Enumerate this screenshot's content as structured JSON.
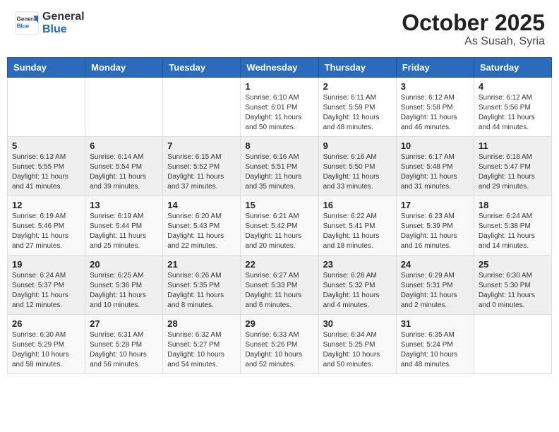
{
  "header": {
    "logo_general": "General",
    "logo_blue": "Blue",
    "month_title": "October 2025",
    "location": "As Susah, Syria"
  },
  "days_of_week": [
    "Sunday",
    "Monday",
    "Tuesday",
    "Wednesday",
    "Thursday",
    "Friday",
    "Saturday"
  ],
  "weeks": [
    [
      {
        "day": "",
        "info": ""
      },
      {
        "day": "",
        "info": ""
      },
      {
        "day": "",
        "info": ""
      },
      {
        "day": "1",
        "info": "Sunrise: 6:10 AM\nSunset: 6:01 PM\nDaylight: 11 hours\nand 50 minutes."
      },
      {
        "day": "2",
        "info": "Sunrise: 6:11 AM\nSunset: 5:59 PM\nDaylight: 11 hours\nand 48 minutes."
      },
      {
        "day": "3",
        "info": "Sunrise: 6:12 AM\nSunset: 5:58 PM\nDaylight: 11 hours\nand 46 minutes."
      },
      {
        "day": "4",
        "info": "Sunrise: 6:12 AM\nSunset: 5:56 PM\nDaylight: 11 hours\nand 44 minutes."
      }
    ],
    [
      {
        "day": "5",
        "info": "Sunrise: 6:13 AM\nSunset: 5:55 PM\nDaylight: 11 hours\nand 41 minutes."
      },
      {
        "day": "6",
        "info": "Sunrise: 6:14 AM\nSunset: 5:54 PM\nDaylight: 11 hours\nand 39 minutes."
      },
      {
        "day": "7",
        "info": "Sunrise: 6:15 AM\nSunset: 5:52 PM\nDaylight: 11 hours\nand 37 minutes."
      },
      {
        "day": "8",
        "info": "Sunrise: 6:16 AM\nSunset: 5:51 PM\nDaylight: 11 hours\nand 35 minutes."
      },
      {
        "day": "9",
        "info": "Sunrise: 6:16 AM\nSunset: 5:50 PM\nDaylight: 11 hours\nand 33 minutes."
      },
      {
        "day": "10",
        "info": "Sunrise: 6:17 AM\nSunset: 5:48 PM\nDaylight: 11 hours\nand 31 minutes."
      },
      {
        "day": "11",
        "info": "Sunrise: 6:18 AM\nSunset: 5:47 PM\nDaylight: 11 hours\nand 29 minutes."
      }
    ],
    [
      {
        "day": "12",
        "info": "Sunrise: 6:19 AM\nSunset: 5:46 PM\nDaylight: 11 hours\nand 27 minutes."
      },
      {
        "day": "13",
        "info": "Sunrise: 6:19 AM\nSunset: 5:44 PM\nDaylight: 11 hours\nand 25 minutes."
      },
      {
        "day": "14",
        "info": "Sunrise: 6:20 AM\nSunset: 5:43 PM\nDaylight: 11 hours\nand 22 minutes."
      },
      {
        "day": "15",
        "info": "Sunrise: 6:21 AM\nSunset: 5:42 PM\nDaylight: 11 hours\nand 20 minutes."
      },
      {
        "day": "16",
        "info": "Sunrise: 6:22 AM\nSunset: 5:41 PM\nDaylight: 11 hours\nand 18 minutes."
      },
      {
        "day": "17",
        "info": "Sunrise: 6:23 AM\nSunset: 5:39 PM\nDaylight: 11 hours\nand 16 minutes."
      },
      {
        "day": "18",
        "info": "Sunrise: 6:24 AM\nSunset: 5:38 PM\nDaylight: 11 hours\nand 14 minutes."
      }
    ],
    [
      {
        "day": "19",
        "info": "Sunrise: 6:24 AM\nSunset: 5:37 PM\nDaylight: 11 hours\nand 12 minutes."
      },
      {
        "day": "20",
        "info": "Sunrise: 6:25 AM\nSunset: 5:36 PM\nDaylight: 11 hours\nand 10 minutes."
      },
      {
        "day": "21",
        "info": "Sunrise: 6:26 AM\nSunset: 5:35 PM\nDaylight: 11 hours\nand 8 minutes."
      },
      {
        "day": "22",
        "info": "Sunrise: 6:27 AM\nSunset: 5:33 PM\nDaylight: 11 hours\nand 6 minutes."
      },
      {
        "day": "23",
        "info": "Sunrise: 6:28 AM\nSunset: 5:32 PM\nDaylight: 11 hours\nand 4 minutes."
      },
      {
        "day": "24",
        "info": "Sunrise: 6:29 AM\nSunset: 5:31 PM\nDaylight: 11 hours\nand 2 minutes."
      },
      {
        "day": "25",
        "info": "Sunrise: 6:30 AM\nSunset: 5:30 PM\nDaylight: 11 hours\nand 0 minutes."
      }
    ],
    [
      {
        "day": "26",
        "info": "Sunrise: 6:30 AM\nSunset: 5:29 PM\nDaylight: 10 hours\nand 58 minutes."
      },
      {
        "day": "27",
        "info": "Sunrise: 6:31 AM\nSunset: 5:28 PM\nDaylight: 10 hours\nand 56 minutes."
      },
      {
        "day": "28",
        "info": "Sunrise: 6:32 AM\nSunset: 5:27 PM\nDaylight: 10 hours\nand 54 minutes."
      },
      {
        "day": "29",
        "info": "Sunrise: 6:33 AM\nSunset: 5:26 PM\nDaylight: 10 hours\nand 52 minutes."
      },
      {
        "day": "30",
        "info": "Sunrise: 6:34 AM\nSunset: 5:25 PM\nDaylight: 10 hours\nand 50 minutes."
      },
      {
        "day": "31",
        "info": "Sunrise: 6:35 AM\nSunset: 5:24 PM\nDaylight: 10 hours\nand 48 minutes."
      },
      {
        "day": "",
        "info": ""
      }
    ]
  ]
}
